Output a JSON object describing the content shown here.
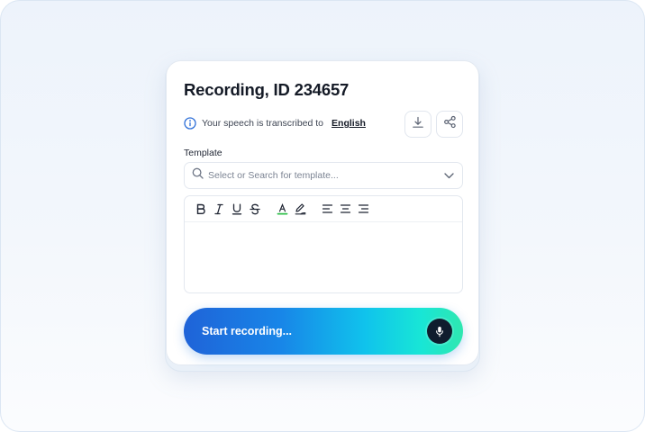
{
  "card": {
    "title": "Recording, ID 234657"
  },
  "info": {
    "text": "Your speech is transcribed to",
    "language": "English",
    "icon": "info-icon"
  },
  "actions": {
    "download_icon": "download-icon",
    "share_icon": "share-icon"
  },
  "template": {
    "label": "Template",
    "placeholder": "Select or Search for template...",
    "value": ""
  },
  "toolbar": {
    "buttons": [
      "bold",
      "italic",
      "underline",
      "strikethrough",
      "font-color",
      "highlight",
      "align-left",
      "align-center",
      "align-right"
    ],
    "font_color": "#2fbf4a"
  },
  "editor": {
    "content": ""
  },
  "record": {
    "label": "Start recording..."
  },
  "colors": {
    "accent_start": "#1f63d8",
    "accent_end": "#2fe7b0",
    "info_icon": "#2e6fd8",
    "mic_button": "#0f1d2e"
  }
}
